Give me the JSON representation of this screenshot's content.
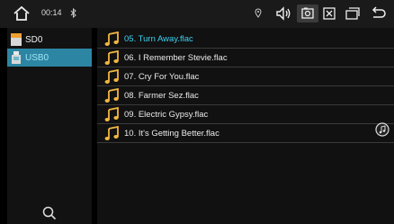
{
  "statusbar": {
    "time": "00:14",
    "icons": [
      "home-icon",
      "bluetooth-icon",
      "location-icon",
      "volume-icon",
      "screen-capture-icon",
      "close-window-icon",
      "multi-window-icon",
      "back-icon"
    ]
  },
  "sidebar": {
    "items": [
      {
        "label": "SD0",
        "icon": "sd-card-icon",
        "selected": false
      },
      {
        "label": "USB0",
        "icon": "usb-drive-icon",
        "selected": true
      }
    ],
    "search_icon": "search-icon"
  },
  "files": [
    {
      "name": "05. Turn Away.flac",
      "playing": true
    },
    {
      "name": "06. I Remember Stevie.flac",
      "playing": false
    },
    {
      "name": "07. Cry For You.flac",
      "playing": false
    },
    {
      "name": "08. Farmer Sez.flac",
      "playing": false
    },
    {
      "name": "09. Electric Gypsy.flac",
      "playing": false
    },
    {
      "name": "10. It's Getting Better.flac",
      "playing": false
    }
  ],
  "colors": {
    "accent": "#3fd0f0",
    "selected_bg": "#2c86a3",
    "note_icon": "#f2b640"
  }
}
